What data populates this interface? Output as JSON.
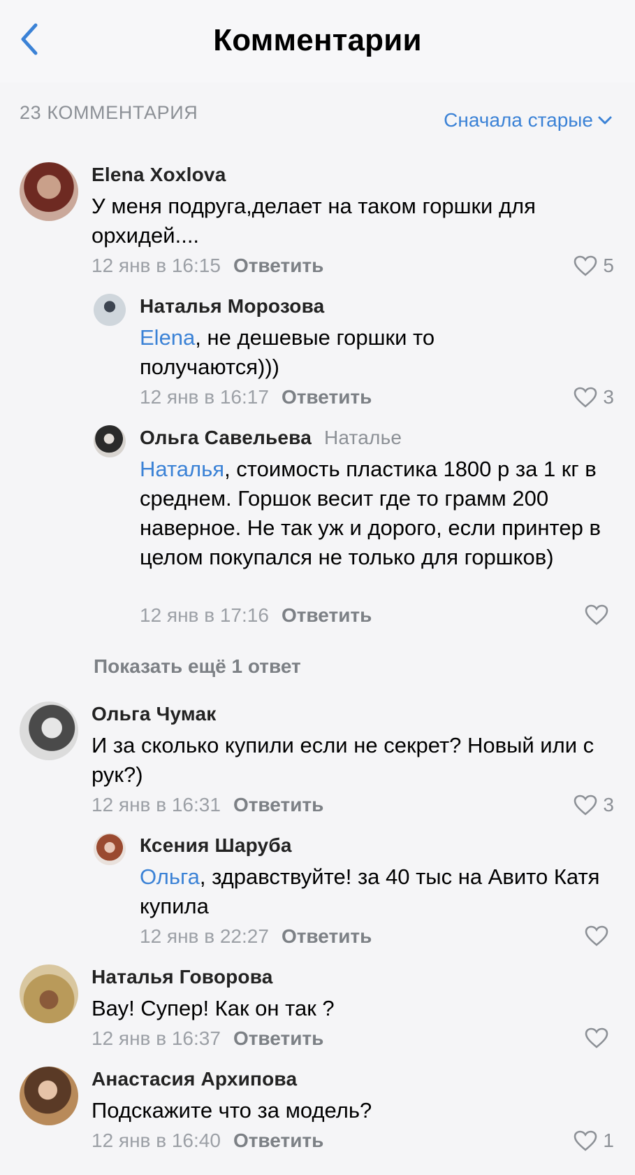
{
  "nav": {
    "title": "Комментарии"
  },
  "header": {
    "count": "23 КОММЕНТАРИЯ",
    "sort": "Сначала старые"
  },
  "comments": [
    {
      "author": "Elena Xoxlova",
      "text": "У меня подруга,делает на таком горшки для орхидей....",
      "date": "12 янв в 16:15",
      "reply": "Ответить",
      "likes": "5"
    },
    {
      "author": "Наталья Морозова",
      "mention": "Elena",
      "text": ", не дешевые горшки то получаются)))",
      "date": "12 янв в 16:17",
      "reply": "Ответить",
      "likes": "3"
    },
    {
      "author": "Ольга Савельева",
      "reply_to": "Наталье",
      "mention": "Наталья",
      "text": ", стоимость пластика 1800 р за 1 кг в среднем. Горшок весит где то грамм 200 наверное. Не так уж и дорого, если принтер в целом покупался не только для горшков)",
      "date": "12 янв в 17:16",
      "reply": "Ответить",
      "likes": ""
    },
    {
      "author": "Ольга Чумак",
      "text": "И за сколько купили если не секрет? Новый или с рук?)",
      "date": "12 янв в 16:31",
      "reply": "Ответить",
      "likes": "3"
    },
    {
      "author": "Ксения Шаруба",
      "mention": "Ольга",
      "text": ", здравствуйте! за 40 тыс на Авито Катя купила",
      "date": "12 янв в 22:27",
      "reply": "Ответить",
      "likes": ""
    },
    {
      "author": "Наталья Говорова",
      "text": "Вау! Супер! Как он так ?",
      "date": "12 янв в 16:37",
      "reply": "Ответить",
      "likes": ""
    },
    {
      "author": "Анастасия Архипова",
      "text": "Подскажите что за модель?",
      "date": "12 янв в 16:40",
      "reply": "Ответить",
      "likes": "1"
    }
  ],
  "show_more": "Показать ещё 1 ответ",
  "colors": {
    "accent": "#3b82d6",
    "meta": "#9ca0a6",
    "background": "#f5f5f7"
  }
}
